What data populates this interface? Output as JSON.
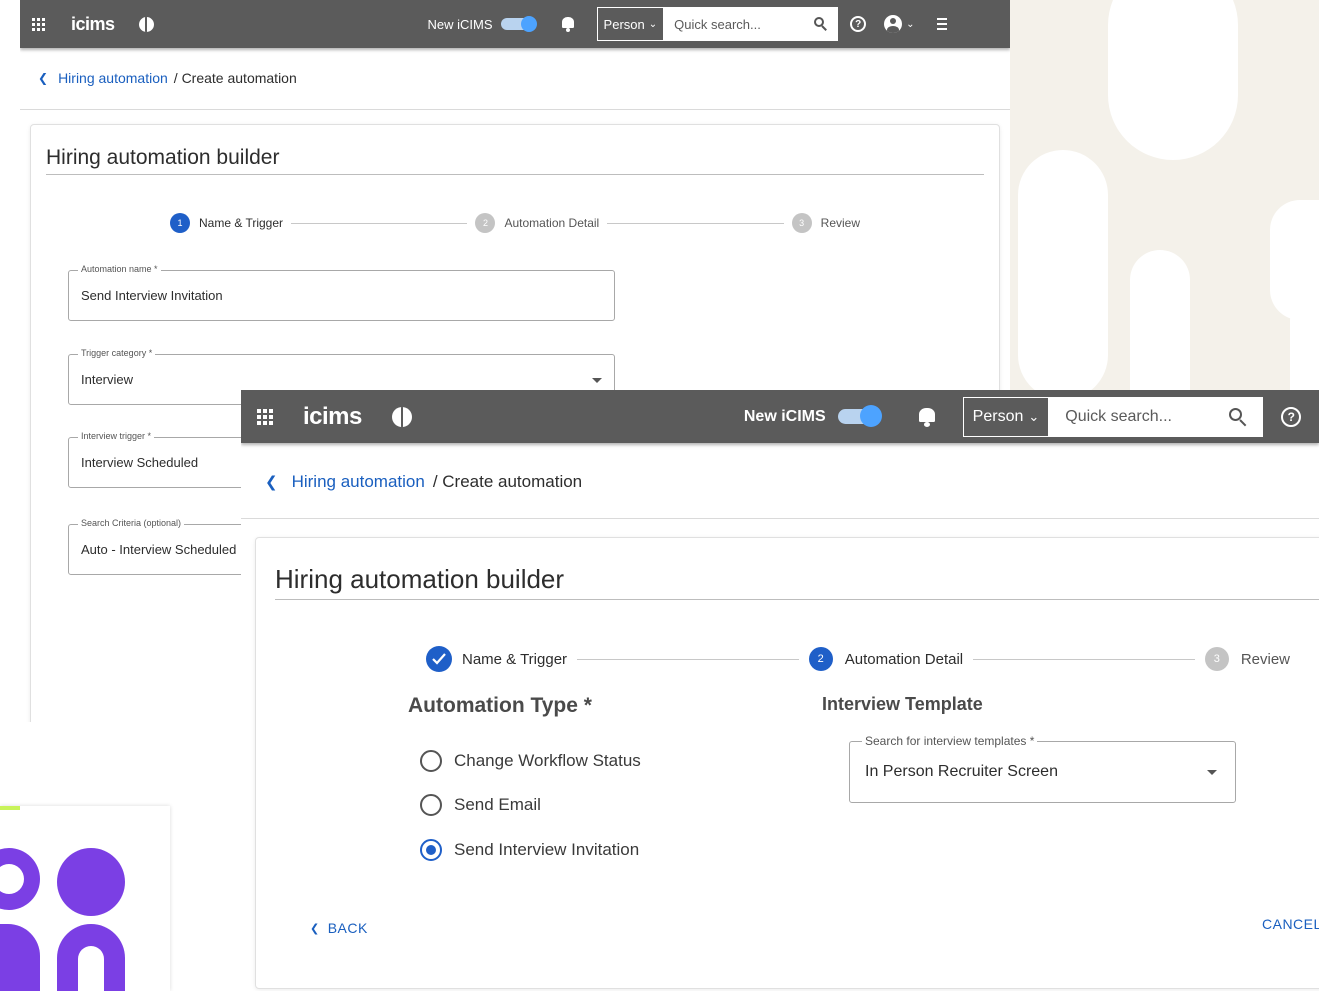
{
  "background": {
    "beige": "#f4f1ea",
    "purple": "#7b3fe4",
    "lime": "#c8f35a"
  },
  "topbar": {
    "brand": "icims",
    "toggle_label": "New iCIMS",
    "person_label": "Person",
    "search_placeholder": "Quick search...",
    "help_glyph": "?",
    "color": "#5b5b5b"
  },
  "breadcrumb": {
    "back_glyph": "❮",
    "link": "Hiring automation",
    "current": "/ Create automation"
  },
  "builder_title": "Hiring automation builder",
  "steps": [
    {
      "number": "1",
      "label": "Name & Trigger"
    },
    {
      "number": "2",
      "label": "Automation Detail"
    },
    {
      "number": "3",
      "label": "Review"
    }
  ],
  "step1_form": {
    "automation_name": {
      "label": "Automation name *",
      "value": "Send Interview Invitation"
    },
    "trigger_category": {
      "label": "Trigger category *",
      "value": "Interview"
    },
    "interview_trigger": {
      "label": "Interview trigger *",
      "value": "Interview Scheduled"
    },
    "search_criteria": {
      "label": "Search Criteria (optional)",
      "value": "Auto - Interview Scheduled"
    }
  },
  "step2_form": {
    "automation_type_heading": "Automation Type *",
    "options": [
      {
        "label": "Change Workflow Status",
        "checked": false
      },
      {
        "label": "Send Email",
        "checked": false
      },
      {
        "label": "Send Interview Invitation",
        "checked": true
      }
    ],
    "interview_template_heading": "Interview Template",
    "template_field": {
      "label": "Search for interview templates *",
      "value": "In Person Recruiter Screen"
    },
    "back_label": "BACK",
    "back_glyph": "❮",
    "cancel_label": "CANCEL"
  },
  "accent": "#1f5fc8"
}
